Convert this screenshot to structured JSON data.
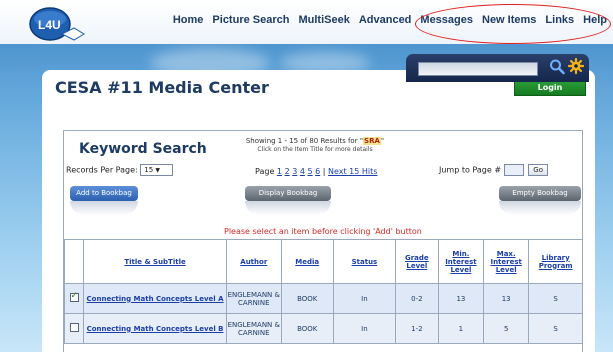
{
  "nav": {
    "items": [
      "Home",
      "Picture Search",
      "MultiSeek",
      "Advanced",
      "Messages",
      "New Items",
      "Links",
      "Help"
    ]
  },
  "logo": {
    "text": "L4U"
  },
  "header": {
    "title": "CESA #11 Media Center",
    "login_label": "Login",
    "search_value": ""
  },
  "search": {
    "title": "Keyword Search",
    "showing_prefix": "Showing 1 - 15 of 80 Results for \"",
    "term": "SRA",
    "showing_suffix": "\"",
    "click_hint": "Click on the Item Title for more details",
    "records_label": "Records Per Page:",
    "records_value": "15",
    "page_label": "Page",
    "pages": [
      "1",
      "2",
      "3",
      "4",
      "5",
      "6"
    ],
    "next_label": "Next 15 Hits",
    "jump_label": "Jump to Page #",
    "go_label": "Go",
    "add_bookbag": "Add to Bookbag",
    "display_bookbag": "Display Bookbag",
    "empty_bookbag": "Empty Bookbag",
    "warning": "Please select an item before clicking 'Add' button"
  },
  "table": {
    "columns": [
      "",
      "Title & SubTitle",
      "Author",
      "Media",
      "Status",
      "Grade Level",
      "Min. Interest Level",
      "Max. Interest Level",
      "Library Program"
    ],
    "rows": [
      {
        "checked": true,
        "title": "Connecting Math Concepts Level A",
        "author": "ENGLEMANN & CARNINE",
        "media": "BOOK",
        "status": "In",
        "grade": "0-2",
        "min": "13",
        "max": "13",
        "program": "S"
      },
      {
        "checked": false,
        "title": "Connecting Math Concepts Level B",
        "author": "ENGLEMANN & CARNINE",
        "media": "BOOK",
        "status": "In",
        "grade": "1-2",
        "min": "1",
        "max": "5",
        "program": "S"
      }
    ]
  },
  "colors": {
    "navy": "#1d3b63",
    "link": "#1a3eaa",
    "warning": "#d92a2a",
    "login_green": "#1f8f2e",
    "highlight_circle": "#e02020"
  }
}
